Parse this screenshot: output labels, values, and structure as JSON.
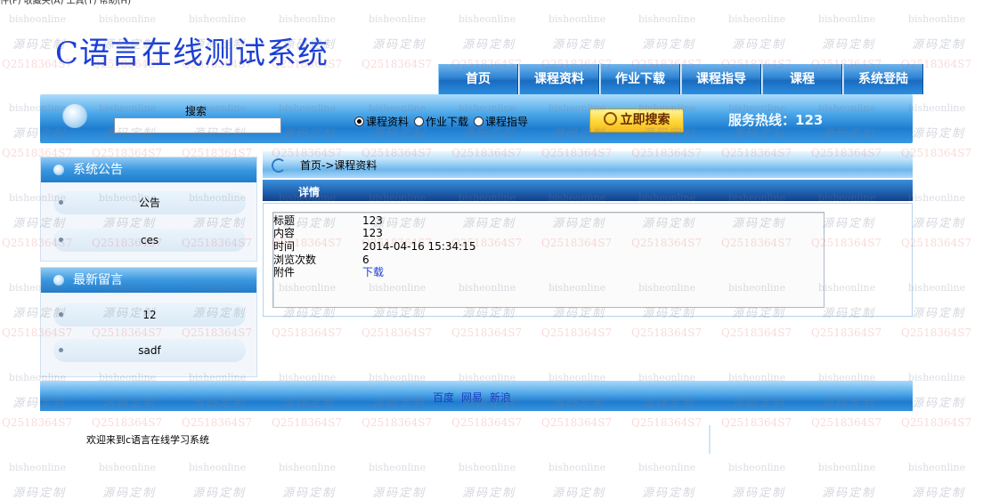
{
  "menubar_fragment": "件(F)  收藏夹(A)  工具(T)  帮助(H)",
  "logo": {
    "letter": "C",
    "text": "语言在线测试系统"
  },
  "nav": [
    "首页",
    "课程资料",
    "作业下载",
    "课程指导",
    "课程",
    "系统登陆"
  ],
  "search": {
    "label": "搜索",
    "value": "",
    "options": [
      "课程资料",
      "作业下载",
      "课程指导"
    ],
    "selected": "课程资料",
    "button": "立即搜索"
  },
  "hotline": "服务热线：123",
  "notice": {
    "title": "系统公告",
    "items": [
      "公告",
      "ces"
    ]
  },
  "messages": {
    "title": "最新留言",
    "items": [
      "12",
      "sadf"
    ]
  },
  "breadcrumb": "首页->课程资料",
  "detail": {
    "header": "详情",
    "rows": [
      {
        "label": "标题",
        "value": "123"
      },
      {
        "label": "内容",
        "value": "123"
      },
      {
        "label": "时间",
        "value": "2014-04-16 15:34:15"
      },
      {
        "label": "浏览次数",
        "value": "6"
      },
      {
        "label": "附件",
        "value": "下载"
      }
    ]
  },
  "footer_links": [
    "百度",
    "网易",
    "新浪"
  ],
  "welcome": "欢迎来到c语言在线学习系统",
  "watermark": {
    "a": "bisheonline",
    "b": "源码定制",
    "c": "Q2518364S7"
  },
  "colors": {
    "logo": "#1a3fd6",
    "accent": "#1f7ccc",
    "link": "#1f3fd0"
  }
}
